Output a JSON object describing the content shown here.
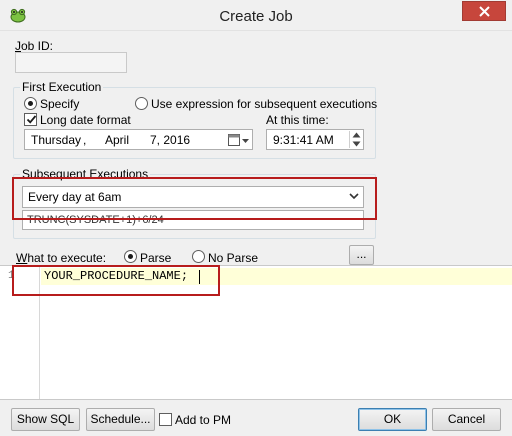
{
  "window": {
    "title": "Create Job",
    "close_icon": "close-icon",
    "app_icon": "frog-icon"
  },
  "job_id": {
    "label": "Job ID:",
    "underlined_char": "J",
    "value": ""
  },
  "first_execution": {
    "legend": "First Execution",
    "specify_label": "Specify",
    "specify_checked": true,
    "expression_label": "Use expression for subsequent executions",
    "expression_checked": false,
    "long_date_label": "Long date format",
    "long_date_checked": true,
    "date": {
      "weekday": "Thursday",
      "sep": ",",
      "month": "April",
      "day_year": "7, 2016"
    },
    "at_time_label": "At this time:",
    "time": "9:31:41 AM"
  },
  "subsequent": {
    "legend": "Subsequent Executions",
    "selected": "Every day at 6am",
    "expression": "TRUNC(SYSDATE+1)+6/24"
  },
  "what_to_execute": {
    "label": "What to execute:",
    "parse_label": "Parse",
    "parse_checked": true,
    "noparse_label": "No Parse",
    "noparse_checked": false,
    "ellipsis_label": "..."
  },
  "editor": {
    "line_number": "1",
    "code": "YOUR_PROCEDURE_NAME;"
  },
  "footer": {
    "show_sql": "Show SQL",
    "schedule": "Schedule...",
    "add_to_pm": "Add to PM",
    "add_to_pm_checked": false,
    "ok": "OK",
    "cancel": "Cancel"
  },
  "colors": {
    "highlight": "#b71c1c",
    "close_button": "#c7463c",
    "current_line": "#ffffd8"
  }
}
